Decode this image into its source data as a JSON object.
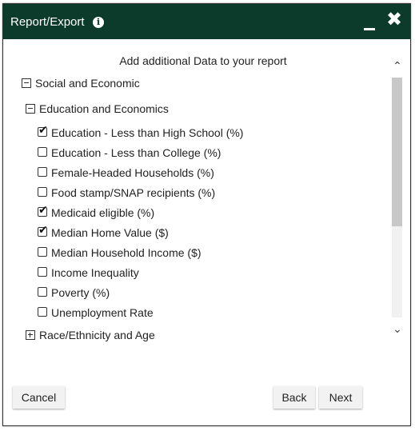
{
  "window": {
    "title": "Report/Export",
    "info_icon": "info-icon",
    "minimize_icon": "minimize-icon",
    "close_icon": "close-icon",
    "close_glyph": "✖",
    "info_glyph": "i"
  },
  "content": {
    "heading": "Add additional Data to your report",
    "tree": {
      "group_social": {
        "label": "Social and Economic",
        "expanded": true
      },
      "group_education": {
        "label": "Education and Economics",
        "expanded": true
      },
      "items": [
        {
          "label": "Education - Less than High School (%)",
          "checked": true
        },
        {
          "label": "Education - Less than College (%)",
          "checked": false
        },
        {
          "label": "Female-Headed Households (%)",
          "checked": false
        },
        {
          "label": "Food stamp/SNAP recipients (%)",
          "checked": false
        },
        {
          "label": "Medicaid eligible (%)",
          "checked": true
        },
        {
          "label": "Median Home Value ($)",
          "checked": true
        },
        {
          "label": "Median Household Income ($)",
          "checked": false
        },
        {
          "label": "Income Inequality",
          "checked": false
        },
        {
          "label": "Poverty (%)",
          "checked": false
        },
        {
          "label": "Unemployment Rate",
          "checked": false
        }
      ],
      "group_race": {
        "label": "Race/Ethnicity and Age",
        "expanded": false
      }
    },
    "check_glyph": "✔"
  },
  "footer": {
    "cancel_label": "Cancel",
    "back_label": "Back",
    "next_label": "Next"
  },
  "colors": {
    "titlebar": "#0d3b2b"
  }
}
